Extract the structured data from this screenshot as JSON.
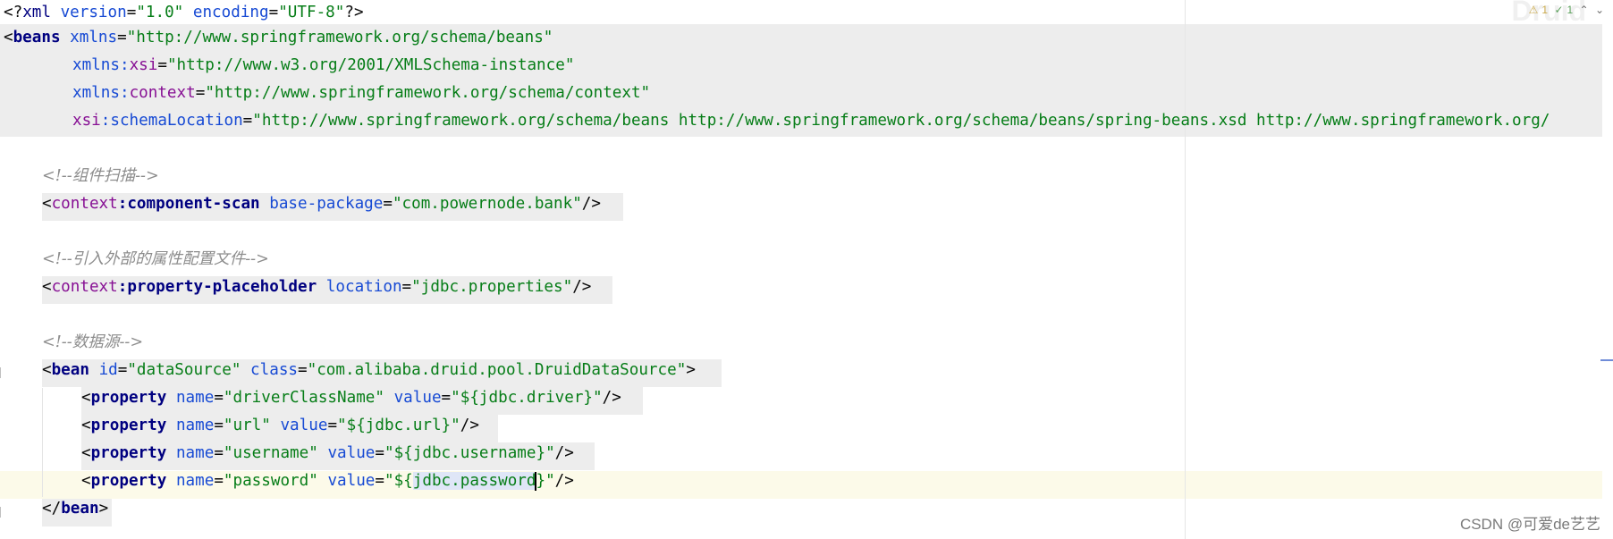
{
  "editor": {
    "lines": [
      {
        "xml_open": "<?",
        "xml_kw": "xml",
        "sp1": " ",
        "a1": "version",
        "eq1": "=",
        "v1": "\"1.0\"",
        "sp2": " ",
        "a2": "encoding",
        "eq2": "=",
        "v2": "\"UTF-8\"",
        "close": "?>"
      },
      {
        "lt": "<",
        "tag": "beans",
        "sp": " ",
        "ns": "xmlns",
        "eq": "=",
        "val": "\"http://www.springframework.org/schema/beans\""
      },
      {
        "ns": "xmlns",
        "colon": ":",
        "attr": "xsi",
        "eq": "=",
        "val": "\"http://www.w3.org/2001/XMLSchema-instance\""
      },
      {
        "ns": "xmlns",
        "colon": ":",
        "attr": "context",
        "eq": "=",
        "val": "\"http://www.springframework.org/schema/context\""
      },
      {
        "ns": "xsi",
        "colon": ":",
        "attr": "schemaLocation",
        "eq": "=",
        "val": "\"http://www.springframework.org/schema/beans http://www.springframework.org/schema/beans/spring-beans.xsd http://www.springframework.org/"
      },
      {
        "comment": "<!--组件扫描-->"
      },
      {
        "lt": "<",
        "ns": "context",
        "colon": ":",
        "tag": "component-scan",
        "sp": " ",
        "attr": "base-package",
        "eq": "=",
        "val": "\"com.powernode.bank\"",
        "end": "/>"
      },
      {
        "comment": "<!--引入外部的属性配置文件-->"
      },
      {
        "lt": "<",
        "ns": "context",
        "colon": ":",
        "tag": "property-placeholder",
        "sp": " ",
        "attr": "location",
        "eq": "=",
        "val": "\"jdbc.properties\"",
        "end": "/>"
      },
      {
        "comment": "<!--数据源-->"
      },
      {
        "lt": "<",
        "tag": "bean",
        "sp1": " ",
        "a1": "id",
        "eq1": "=",
        "v1": "\"dataSource\"",
        "sp2": " ",
        "a2": "class",
        "eq2": "=",
        "v2": "\"com.alibaba.druid.pool.DruidDataSource\"",
        "gt": ">"
      },
      {
        "lt": "<",
        "tag": "property",
        "sp1": " ",
        "a1": "name",
        "eq1": "=",
        "v1": "\"driverClassName\"",
        "sp2": " ",
        "a2": "value",
        "eq2": "=",
        "v2": "\"${jdbc.driver}\"",
        "end": "/>"
      },
      {
        "lt": "<",
        "tag": "property",
        "sp1": " ",
        "a1": "name",
        "eq1": "=",
        "v1": "\"url\"",
        "sp2": " ",
        "a2": "value",
        "eq2": "=",
        "v2": "\"${jdbc.url}\"",
        "end": "/>"
      },
      {
        "lt": "<",
        "tag": "property",
        "sp1": " ",
        "a1": "name",
        "eq1": "=",
        "v1": "\"username\"",
        "sp2": " ",
        "a2": "value",
        "eq2": "=",
        "v2": "\"${jdbc.username}\"",
        "end": "/>"
      },
      {
        "lt": "<",
        "tag": "property",
        "sp1": " ",
        "a1": "name",
        "eq1": "=",
        "v1": "\"password\"",
        "sp2": " ",
        "a2": "value",
        "eq2": "=",
        "v2a": "\"${",
        "v2sel": "jdbc.password",
        "v2b": "}\"",
        "end": "/>"
      },
      {
        "lt": "</",
        "tag": "bean",
        "gt": ">"
      }
    ]
  },
  "inspections": {
    "warning_icon": "⚠",
    "warning_count": "1",
    "ok_icon": "✓",
    "ok_count": "1",
    "up_icon": "⌃",
    "down_icon": "⌄"
  },
  "watermark": "CSDN @可爱de艺艺",
  "colors": {
    "tag": "#000080",
    "namespace": "#871094",
    "attribute": "#174ad4",
    "value": "#067d17",
    "comment": "#8c8c8c",
    "current_line": "#fcfae9",
    "tag_highlight": "#ededed"
  }
}
